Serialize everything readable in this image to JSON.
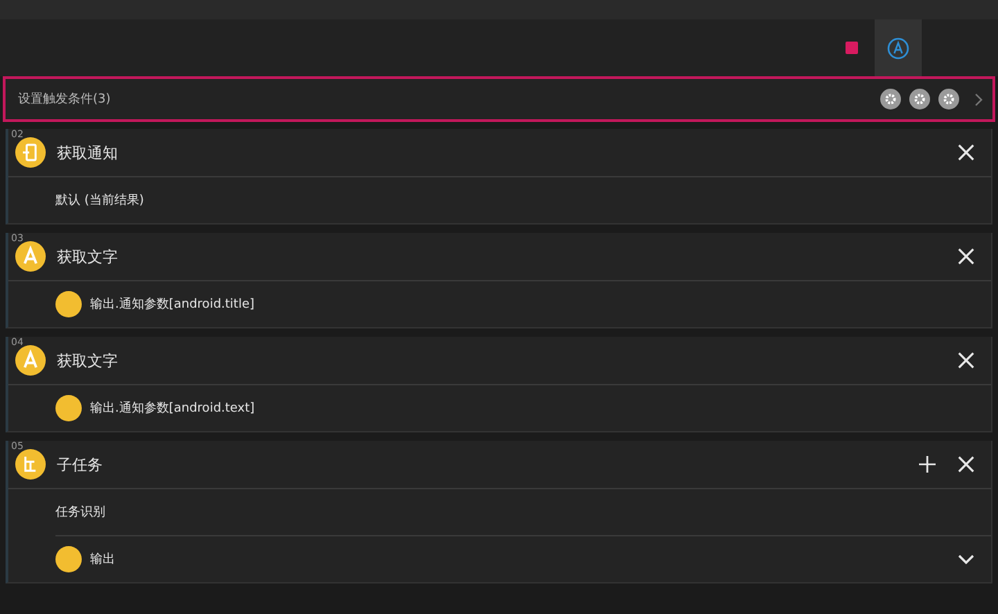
{
  "header": {
    "tabs": [
      {
        "kind": "stop",
        "selected": false
      },
      {
        "kind": "auto",
        "selected": true
      }
    ]
  },
  "trigger": {
    "label": "设置触发条件(3)",
    "buttons": [
      {
        "kind": "gear"
      },
      {
        "kind": "gear"
      },
      {
        "kind": "gear"
      }
    ]
  },
  "steps": [
    {
      "number": "02",
      "kind": "notification",
      "title": "获取通知",
      "actions": [
        {
          "kind": "close"
        }
      ],
      "rows": [
        {
          "kind": "text",
          "label": "默认 (当前结果)"
        }
      ]
    },
    {
      "number": "03",
      "kind": "letter",
      "title": "获取文字",
      "actions": [
        {
          "kind": "close"
        }
      ],
      "rows": [
        {
          "kind": "output",
          "label": "输出.通知参数[android.title]"
        }
      ]
    },
    {
      "number": "04",
      "kind": "letter",
      "title": "获取文字",
      "actions": [
        {
          "kind": "close"
        }
      ],
      "rows": [
        {
          "kind": "output",
          "label": "输出.通知参数[android.text]"
        }
      ]
    },
    {
      "number": "05",
      "kind": "subtask",
      "title": "子任务",
      "actions": [
        {
          "kind": "add"
        },
        {
          "kind": "close"
        }
      ],
      "rows": [
        {
          "kind": "text",
          "label": "任务识别"
        },
        {
          "kind": "output-menu",
          "label": "输出"
        }
      ]
    }
  ]
}
